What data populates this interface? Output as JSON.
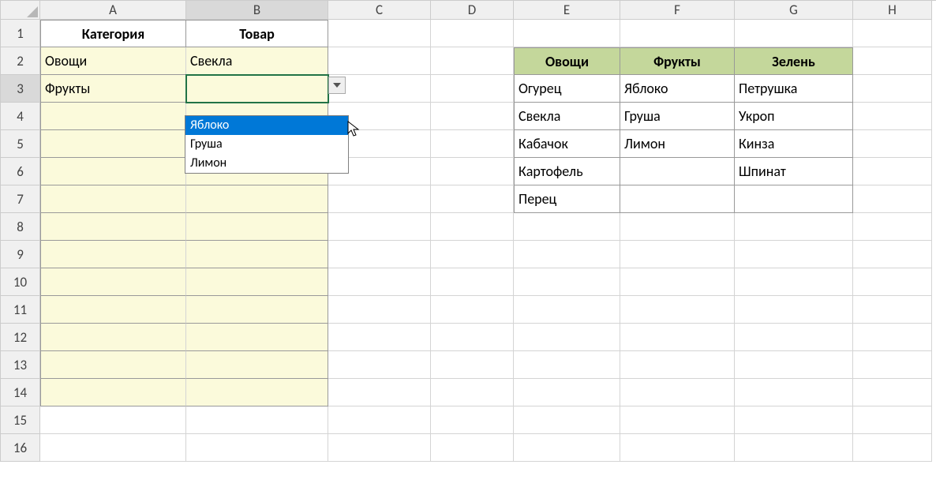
{
  "columns": [
    "A",
    "B",
    "C",
    "D",
    "E",
    "F",
    "G",
    "H"
  ],
  "rows": 16,
  "headers": {
    "a1": "Категория",
    "b1": "Товар"
  },
  "left_table": {
    "a2": "Овощи",
    "b2": "Свекла",
    "a3": "Фрукты",
    "b3": ""
  },
  "lookup": {
    "e2": "Овощи",
    "f2": "Фрукты",
    "g2": "Зелень",
    "e_col": [
      "Огурец",
      "Свекла",
      "Кабачок",
      "Картофель",
      "Перец"
    ],
    "f_col": [
      "Яблоко",
      "Груша",
      "Лимон"
    ],
    "g_col": [
      "Петрушка",
      "Укроп",
      "Кинза",
      "Шпинат"
    ]
  },
  "dropdown": {
    "options": [
      "Яблоко",
      "Груша",
      "Лимон"
    ],
    "selected_index": 0
  }
}
